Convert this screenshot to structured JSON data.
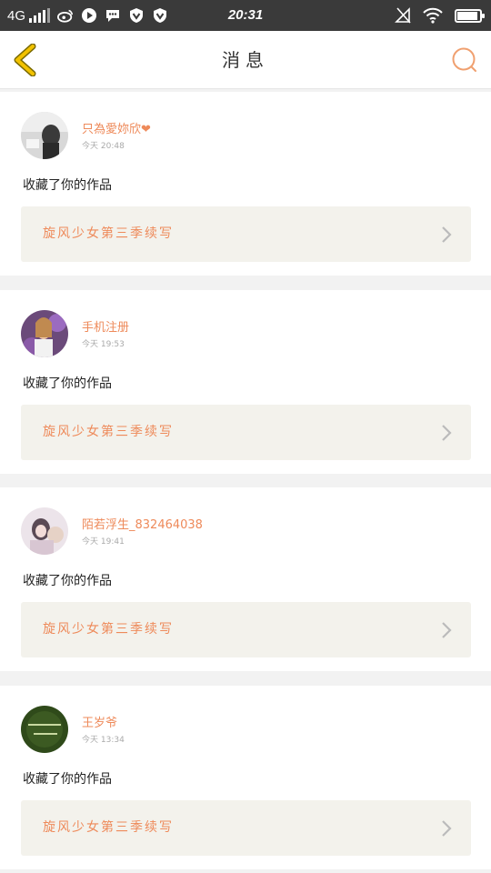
{
  "status_bar": {
    "network": "4G",
    "time": "20:31",
    "signal_bars": 4,
    "icons": [
      "weibo-icon",
      "play-icon",
      "chat-bubble-icon",
      "vpn-shield-icon",
      "vpn-shield-icon",
      "no-sim-icon",
      "wifi-icon",
      "battery-icon"
    ]
  },
  "header": {
    "title": "消息",
    "back_icon": "chevron-left-icon",
    "search_icon": "search-icon",
    "accent_color": "#ee8a5a",
    "back_color": "#e6b800"
  },
  "messages": [
    {
      "user": "只為愛妳欣❤",
      "time": "今天 20:48",
      "action": "收藏了你的作品",
      "work": "旋风少女第三季续写"
    },
    {
      "user": "手机注册",
      "time": "今天 19:53",
      "action": "收藏了你的作品",
      "work": "旋风少女第三季续写"
    },
    {
      "user": "陌若浮生_832464038",
      "time": "今天 19:41",
      "action": "收藏了你的作品",
      "work": "旋风少女第三季续写"
    },
    {
      "user": "王岁爷",
      "time": "今天 13:34",
      "action": "收藏了你的作品",
      "work": "旋风少女第三季续写"
    }
  ]
}
